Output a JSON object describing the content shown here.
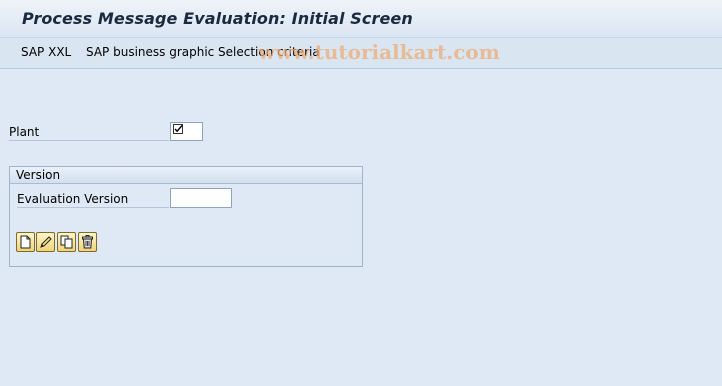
{
  "header": {
    "title": "Process Message Evaluation: Initial Screen"
  },
  "toolbar": {
    "items": [
      "SAP XXL",
      "SAP business graphic",
      "Selection criteria"
    ]
  },
  "watermark": "www.tutorialkart.com",
  "form": {
    "plant_label": "Plant",
    "plant_checked": true
  },
  "version_group": {
    "title": "Version",
    "evaluation_version_label": "Evaluation Version",
    "evaluation_version_value": "",
    "buttons": [
      "create-icon",
      "change-icon",
      "copy-icon",
      "delete-icon"
    ]
  }
}
